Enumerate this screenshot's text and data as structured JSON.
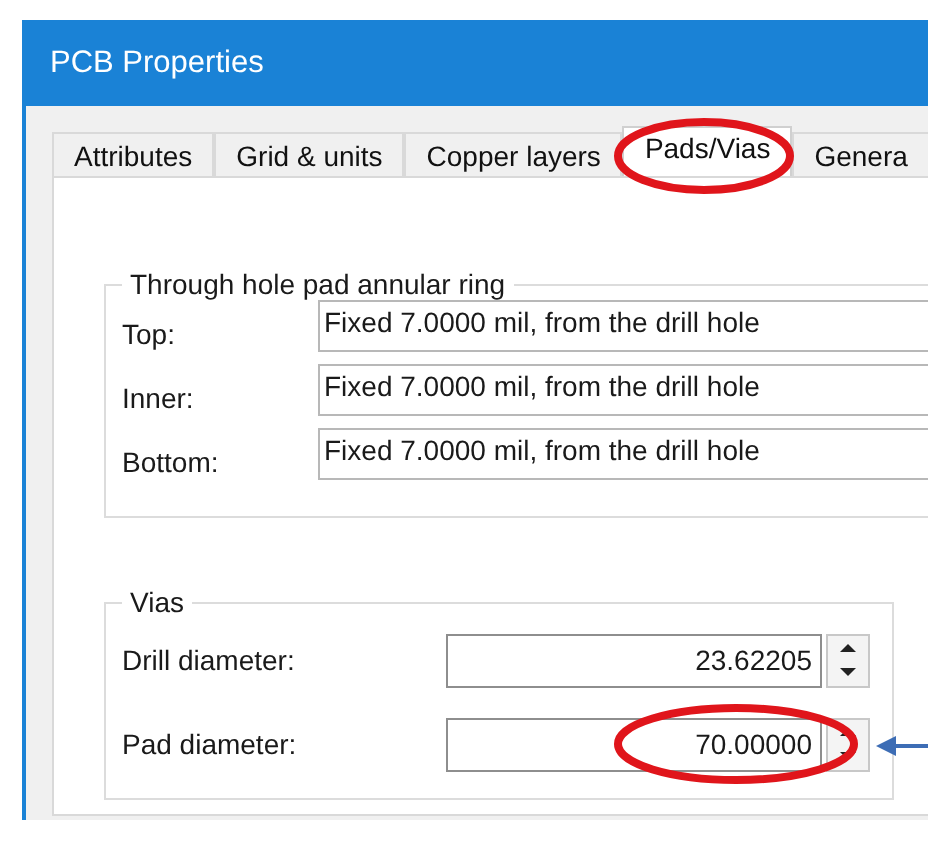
{
  "window": {
    "title": "PCB Properties"
  },
  "tabs": [
    {
      "label": "Attributes",
      "selected": false
    },
    {
      "label": "Grid & units",
      "selected": false
    },
    {
      "label": "Copper layers",
      "selected": false
    },
    {
      "label": "Pads/Vias",
      "selected": true
    },
    {
      "label": "Genera",
      "selected": false
    }
  ],
  "annular_ring": {
    "title": "Through hole pad annular ring",
    "rows": [
      {
        "label": "Top:",
        "value": "Fixed 7.0000 mil, from the drill hole"
      },
      {
        "label": "Inner:",
        "value": "Fixed 7.0000 mil, from the drill hole"
      },
      {
        "label": "Bottom:",
        "value": "Fixed 7.0000 mil, from the drill hole"
      }
    ]
  },
  "vias": {
    "title": "Vias",
    "fields": [
      {
        "label": "Drill diameter:",
        "value": "23.62205"
      },
      {
        "label": "Pad diameter:",
        "value": "70.00000"
      }
    ]
  }
}
